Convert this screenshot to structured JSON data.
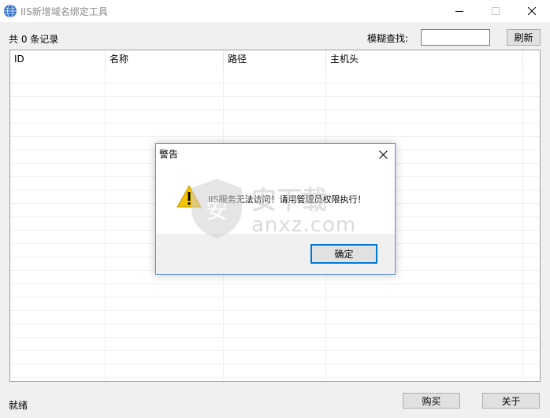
{
  "window": {
    "title": "IIS新增域名绑定工具",
    "icon": "globe-icon"
  },
  "toolbar": {
    "count_text": "共 0 条记录",
    "search_label": "模糊查找:",
    "search_value": "",
    "refresh_label": "刷新"
  },
  "table": {
    "columns": [
      "ID",
      "名称",
      "路径",
      "主机头"
    ],
    "rows": []
  },
  "status": {
    "text": "就绪",
    "buy_label": "购买",
    "about_label": "关于"
  },
  "dialog": {
    "title": "警告",
    "message": "IIS服务无法访问！请用管理员权限执行！",
    "ok_label": "确定",
    "icon": "warning-icon"
  },
  "watermark": {
    "text": "anxz.com",
    "logo_text": "安下载"
  },
  "colors": {
    "dialog_border": "#5a8ec8",
    "button_focus": "#0078d7",
    "warning_yellow": "#f5c400"
  }
}
